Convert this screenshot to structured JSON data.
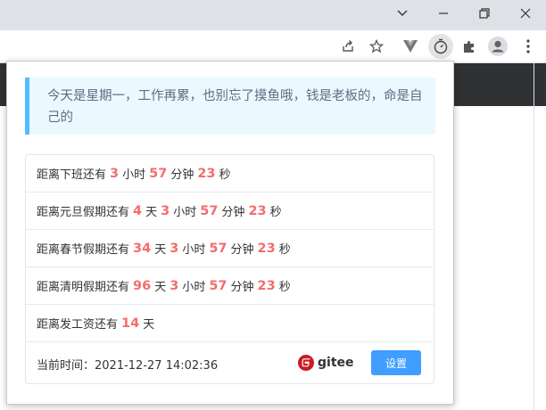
{
  "popup": {
    "quote": "今天是星期一，工作再累，也别忘了摸鱼哦，钱是老板的，命是自己的",
    "rows": [
      {
        "prefix": "距离下班还有",
        "parts": [
          {
            "n": "3",
            "u": "小时"
          },
          {
            "n": "57",
            "u": "分钟"
          },
          {
            "n": "23",
            "u": "秒"
          }
        ]
      },
      {
        "prefix": "距离元旦假期还有",
        "parts": [
          {
            "n": "4",
            "u": "天"
          },
          {
            "n": "3",
            "u": "小时"
          },
          {
            "n": "57",
            "u": "分钟"
          },
          {
            "n": "23",
            "u": "秒"
          }
        ]
      },
      {
        "prefix": "距离春节假期还有",
        "parts": [
          {
            "n": "34",
            "u": "天"
          },
          {
            "n": "3",
            "u": "小时"
          },
          {
            "n": "57",
            "u": "分钟"
          },
          {
            "n": "23",
            "u": "秒"
          }
        ]
      },
      {
        "prefix": "距离清明假期还有",
        "parts": [
          {
            "n": "96",
            "u": "天"
          },
          {
            "n": "3",
            "u": "小时"
          },
          {
            "n": "57",
            "u": "分钟"
          },
          {
            "n": "23",
            "u": "秒"
          }
        ]
      },
      {
        "prefix": "距离发工资还有",
        "parts": [
          {
            "n": "14",
            "u": "天"
          }
        ]
      }
    ],
    "current_time_label": "当前时间：",
    "current_time_value": "2021-12-27 14:02:36",
    "gitee_label": "gitee",
    "settings_button": "设置"
  },
  "colors": {
    "accent": "#409eff",
    "highlight": "#f56c6c",
    "quote_border": "#50bfff",
    "quote_bg": "#ecf8ff"
  },
  "icons": [
    "chevron-down-icon",
    "minimize-icon",
    "restore-icon",
    "close-icon",
    "share-icon",
    "star-icon",
    "vue-devtools-icon",
    "timer-icon",
    "puzzle-icon",
    "profile-icon",
    "kebab-menu-icon",
    "gitee-logo-icon"
  ]
}
